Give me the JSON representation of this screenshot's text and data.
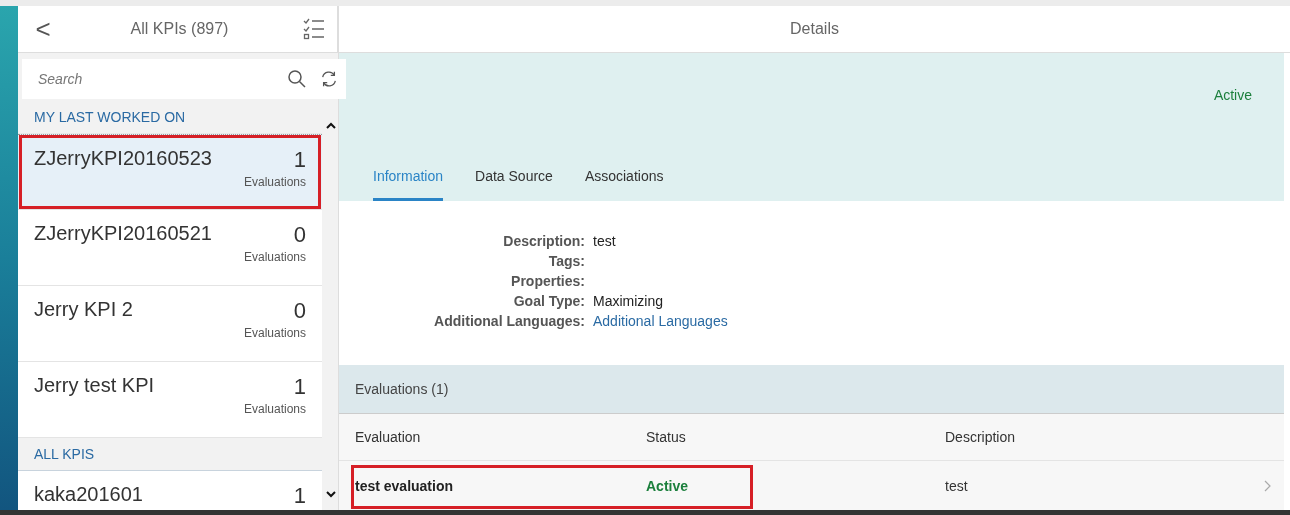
{
  "master": {
    "back": "<",
    "title": "All KPIs (897)",
    "search": {
      "placeholder": "Search"
    },
    "groups": [
      {
        "title": "MY LAST WORKED ON",
        "items": [
          {
            "name": "ZJerryKPI20160523",
            "count": "1",
            "unit": "Evaluations",
            "selected": true,
            "highlighted": true
          },
          {
            "name": "ZJerryKPI20160521",
            "count": "0",
            "unit": "Evaluations",
            "selected": false,
            "highlighted": false
          },
          {
            "name": "Jerry KPI 2",
            "count": "0",
            "unit": "Evaluations",
            "selected": false,
            "highlighted": false
          },
          {
            "name": "Jerry test KPI",
            "count": "1",
            "unit": "Evaluations",
            "selected": false,
            "highlighted": false
          }
        ]
      },
      {
        "title": "ALL KPIS",
        "items": [
          {
            "name": "kaka201601",
            "count": "1",
            "selected": false,
            "highlighted": false
          }
        ]
      }
    ]
  },
  "detail": {
    "title": "Details",
    "status": "Active",
    "tabs": [
      {
        "label": "Information",
        "selected": true
      },
      {
        "label": "Data Source",
        "selected": false
      },
      {
        "label": "Associations",
        "selected": false
      }
    ],
    "fields": [
      {
        "label": "Description:",
        "value": "test"
      },
      {
        "label": "Tags:"
      },
      {
        "label": "Properties:"
      },
      {
        "label": "Goal Type:",
        "value": "Maximizing"
      },
      {
        "label": "Additional Languages:",
        "value": "Additional Languages",
        "kind": "link"
      }
    ],
    "evaluations": {
      "title": "Evaluations (1)",
      "columns": [
        "Evaluation",
        "Status",
        "Description"
      ],
      "rows": [
        {
          "evaluation": "test evaluation",
          "status": "Active",
          "description": "test",
          "highlighted": true
        }
      ]
    }
  }
}
